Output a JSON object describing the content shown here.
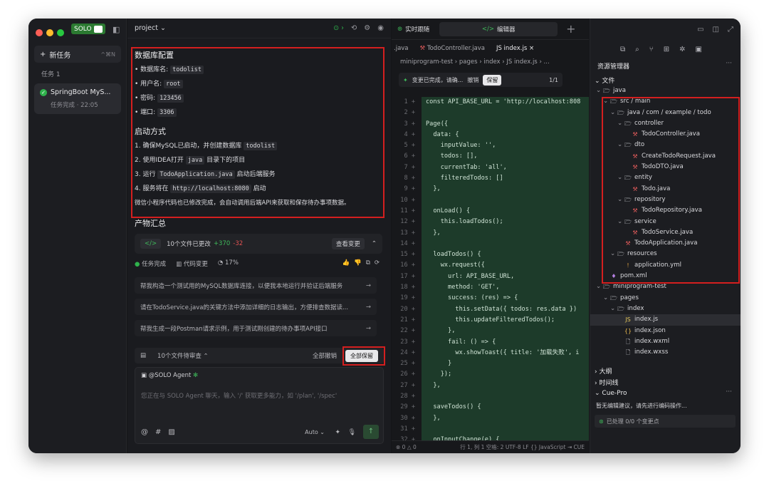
{
  "window": {
    "badge": "SOLO"
  },
  "sidebar": {
    "new_task": "新任务",
    "new_task_key": "^⌘N",
    "task_label": "任务 1",
    "task_title": "SpringBoot MyS...",
    "task_status": "任务完成 · 22:05"
  },
  "header": {
    "project": "project ⌄"
  },
  "content": {
    "h1": "数据库配置",
    "db": [
      "数据库名: ",
      "用户名: ",
      "密码: ",
      "端口: "
    ],
    "db_vals": [
      "todolist",
      "root",
      "123456",
      "3306"
    ],
    "h2": "启动方式",
    "s1a": "1. 确保MySQL已启动，并创建数据库 ",
    "s1b": "todolist",
    "s2a": "2. 使用IDEA打开 ",
    "s2b": "java",
    "s2c": " 目录下的项目",
    "s3a": "3. 运行 ",
    "s3b": "TodoApplication.java",
    "s3c": " 启动后端服务",
    "s4a": "4. 服务将在 ",
    "s4b": "http://localhost:8080",
    "s4c": " 启动",
    "note": "微信小程序代码也已修改完成，会自动调用后端API来获取和保存待办事项数据。",
    "h3": "产物汇总"
  },
  "changes": {
    "files": "10个文件已更改",
    "add": "+370",
    "del": "-32",
    "view": "查看变更"
  },
  "stats": {
    "done": "任务完成",
    "code": "代码变更",
    "pct": "17%"
  },
  "suggestions": [
    "帮我构造一个测试用的MySQL数据库连接，以便我本地运行并验证后端服务",
    "请在TodoService.java的关键方法中添加详细的日志输出，方便排查数据读...",
    "帮我生成一段Postman请求示例，用于测试刚创建的待办事项API接口"
  ],
  "pending": {
    "label": "10个文件待审查 ⌃",
    "undo": "全部撤销",
    "keep": "全部保留"
  },
  "input": {
    "agent": "@SOLO Agent",
    "placeholder": "您正在与 SOLO Agent 聊天，输入 '/' 获取更多能力，如 '/plan', '/spec'",
    "mode": "Auto ⌄"
  },
  "editor": {
    "tab_live": "实时跟随",
    "tab_edit": "编辑器",
    "files": [
      ".java",
      "TodoController.java",
      "JS index.js ×"
    ],
    "breadcrumb": "miniprogram-test  ›  pages  ›  index  ›  JS index.js  ›  ...",
    "change_msg": "变更已完成，请确...",
    "undo": "撤销",
    "keep": "保留",
    "nav": "1/1",
    "lines": [
      "const API_BASE_URL = 'http://localhost:808",
      "",
      "Page({",
      "  data: {",
      "    inputValue: '',",
      "    todos: [],",
      "    currentTab: 'all',",
      "    filteredTodos: []",
      "  },",
      "",
      "  onLoad() {",
      "    this.loadTodos();",
      "  },",
      "",
      "  loadTodos() {",
      "    wx.request({",
      "      url: API_BASE_URL,",
      "      method: 'GET',",
      "      success: (res) => {",
      "        this.setData({ todos: res.data })",
      "        this.updateFilteredTodos();",
      "      },",
      "      fail: () => {",
      "        wx.showToast({ title: '加载失败', i",
      "      }",
      "    });",
      "  },",
      "",
      "  saveTodos() {",
      "  },",
      "",
      "  onInputChange(e) {"
    ],
    "status": "行 1, 列 1  空格: 2  UTF-8  LF  {}  JavaScript  ⇥ CUE",
    "status_left": "⊗ 0 △ 0"
  },
  "explorer": {
    "title": "资源管理器",
    "files_section": "文件",
    "tree": [
      {
        "name": "java",
        "indent": 0,
        "type": "dir"
      },
      {
        "name": "src / main",
        "indent": 1,
        "type": "dir"
      },
      {
        "name": "java / com / example / todo",
        "indent": 2,
        "type": "dir"
      },
      {
        "name": "controller",
        "indent": 3,
        "type": "dir"
      },
      {
        "name": "TodoController.java",
        "indent": 4,
        "type": "java"
      },
      {
        "name": "dto",
        "indent": 3,
        "type": "dir"
      },
      {
        "name": "CreateTodoRequest.java",
        "indent": 4,
        "type": "java"
      },
      {
        "name": "TodoDTO.java",
        "indent": 4,
        "type": "java"
      },
      {
        "name": "entity",
        "indent": 3,
        "type": "dir"
      },
      {
        "name": "Todo.java",
        "indent": 4,
        "type": "java"
      },
      {
        "name": "repository",
        "indent": 3,
        "type": "dir"
      },
      {
        "name": "TodoRepository.java",
        "indent": 4,
        "type": "java"
      },
      {
        "name": "service",
        "indent": 3,
        "type": "dir"
      },
      {
        "name": "TodoService.java",
        "indent": 4,
        "type": "java"
      },
      {
        "name": "TodoApplication.java",
        "indent": 3,
        "type": "java"
      },
      {
        "name": "resources",
        "indent": 2,
        "type": "dir"
      },
      {
        "name": "application.yml",
        "indent": 3,
        "type": "yml"
      },
      {
        "name": "pom.xml",
        "indent": 1,
        "type": "pom"
      },
      {
        "name": "miniprogram-test",
        "indent": 0,
        "type": "dir"
      },
      {
        "name": "pages",
        "indent": 1,
        "type": "dir"
      },
      {
        "name": "index",
        "indent": 2,
        "type": "dir"
      },
      {
        "name": "index.js",
        "indent": 3,
        "type": "js",
        "sel": true
      },
      {
        "name": "index.json",
        "indent": 3,
        "type": "json"
      },
      {
        "name": "index.wxml",
        "indent": 3,
        "type": "file"
      },
      {
        "name": "index.wxss",
        "indent": 3,
        "type": "file"
      }
    ],
    "outline": "大纲",
    "timeline": "时间线",
    "cue": "Cue-Pro",
    "cue_msg": "暂无编辑建议，请先进行编码操作...",
    "cue_status": "已处理 0/0 个变更点"
  }
}
